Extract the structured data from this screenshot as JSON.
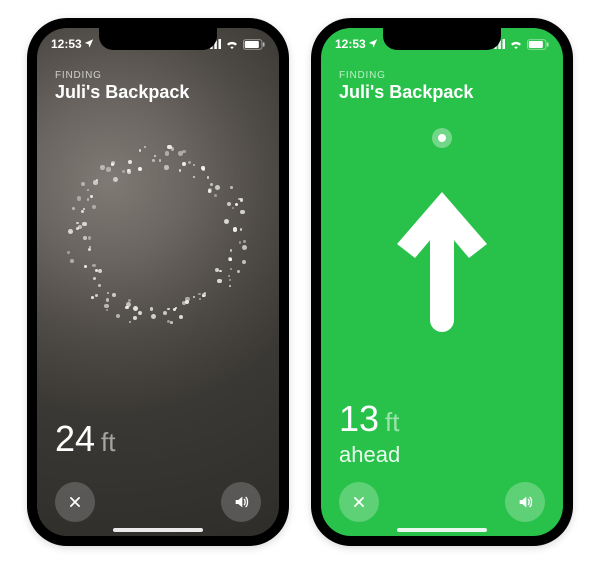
{
  "left": {
    "status": {
      "time": "12:53"
    },
    "finding_label": "FINDING",
    "item_name": "Juli's Backpack",
    "distance_value": "24",
    "distance_unit": "ft"
  },
  "right": {
    "status": {
      "time": "12:53"
    },
    "finding_label": "FINDING",
    "item_name": "Juli's Backpack",
    "distance_value": "13",
    "distance_unit": "ft",
    "direction_label": "ahead"
  }
}
